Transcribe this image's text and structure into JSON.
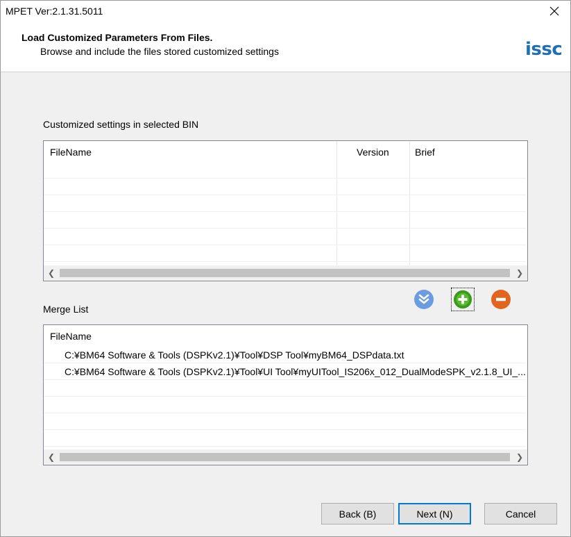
{
  "window": {
    "title": "MPET Ver:2.1.31.5011"
  },
  "header": {
    "title": "Load Customized Parameters From Files.",
    "subtitle": "Browse and include the files stored customized settings",
    "logo_text": "issc",
    "logo_color": "#1f6fb5"
  },
  "customized_settings": {
    "label": "Customized settings in selected BIN",
    "columns": [
      "FileName",
      "Version",
      "Brief"
    ],
    "rows": []
  },
  "merge_list": {
    "label": "Merge List",
    "columns": [
      "FileName"
    ],
    "rows": [
      "C:¥BM64 Software & Tools (DSPKv2.1)¥Tool¥DSP Tool¥myBM64_DSPdata.txt",
      "C:¥BM64 Software & Tools (DSPKv2.1)¥Tool¥UI Tool¥myUITool_IS206x_012_DualModeSPK_v2.1.8_UI_..."
    ]
  },
  "toolbar": {
    "move_down_icon": "double-chevron-down-icon",
    "add_icon": "plus-circle-icon",
    "remove_icon": "minus-circle-icon",
    "colors": {
      "move_down": "#6b9be0",
      "add": "#3a9a1c",
      "remove": "#e2641e"
    }
  },
  "buttons": {
    "back": "Back (B)",
    "next": "Next (N)",
    "cancel": "Cancel"
  }
}
